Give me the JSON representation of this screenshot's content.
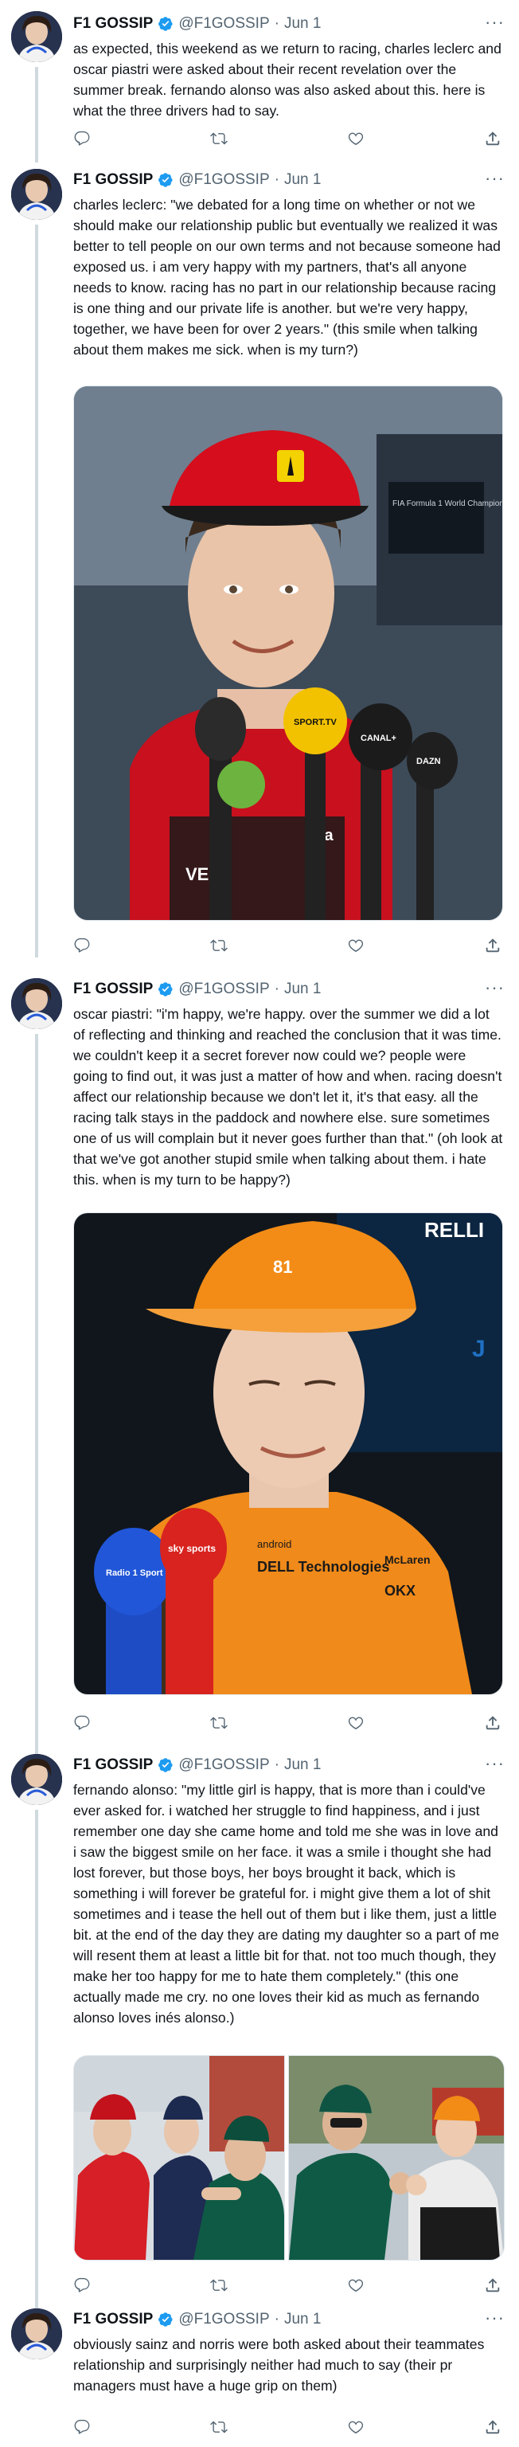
{
  "colors": {
    "accent": "#1d9bf0",
    "text": "#0f1419",
    "muted": "#536471",
    "divider": "#eff3f4"
  },
  "icons": [
    "reply-icon",
    "retweet-icon",
    "like-icon",
    "share-icon",
    "verified-badge-icon",
    "more-options-icon"
  ],
  "tweets": [
    {
      "name": "F1 GOSSIP",
      "handle": "@F1GOSSIP",
      "date": "Jun 1",
      "dot": "·",
      "more": "···",
      "text": "as expected, this weekend as we return to racing, charles leclerc and oscar piastri were asked about their recent revelation over the summer break. fernando alonso was also asked about this. here is what the three drivers had to say."
    },
    {
      "name": "F1 GOSSIP",
      "handle": "@F1GOSSIP",
      "date": "Jun 1",
      "dot": "·",
      "more": "···",
      "text": "charles leclerc: \"we debated for a long time on whether or not we should make our relationship public but eventually we realized it was better to tell people on our own terms and not because someone had exposed us. i am very happy with my partners, that's all anyone needs to know. racing has no part in our relationship because racing is one thing and our private life is another. but we're very happy, together, we have been for over 2 years.\" (this smile when talking about them makes me sick. when is my turn?)",
      "media": {
        "mic_labels": [
          "SPORT.TV",
          "CANAL+",
          "DAZN"
        ],
        "sign_text": "FIA Formula 1 World Championship",
        "sponsor_text": "Ca",
        "sponsor2_text": "VE"
      }
    },
    {
      "name": "F1 GOSSIP",
      "handle": "@F1GOSSIP",
      "date": "Jun 1",
      "dot": "·",
      "more": "···",
      "text": "oscar piastri: \"i'm happy, we're happy. over the summer we did a lot of reflecting and thinking and reached the conclusion that it was time. we couldn't keep it a secret forever now could we? people were going to find out, it was just a matter of how and when. racing doesn't affect our relationship because we don't let it, it's that easy. all the racing talk stays in the paddock and nowhere else. sure sometimes one of us will complain but it never goes further than that.\" (oh look at that we've got another stupid smile when talking about them. i hate this. when is my turn to be happy?)",
      "media": {
        "cap_number": "81",
        "backdrop_text": "RELLI",
        "backdrop_text2": "J",
        "sponsors": [
          "android",
          "DELL Technologies",
          "McLaren",
          "OKX"
        ],
        "mic_labels": [
          "Radio 1 Sport",
          "sky sports"
        ]
      }
    },
    {
      "name": "F1 GOSSIP",
      "handle": "@F1GOSSIP",
      "date": "Jun 1",
      "dot": "·",
      "more": "···",
      "text": "fernando alonso: \"my little girl is happy, that is more than i could've ever asked for. i watched her struggle to find happiness, and i just remember one day she came home and told me she was in love and i saw the biggest smile on her face. it was a smile i thought she had lost forever, but those boys, her boys brought it back, which is something i will forever be grateful for. i might give them a lot of shit sometimes and i tease the hell out of them but i like them, just a little bit. at the end of the day they are dating my daughter so a part of me will resent them at least a little bit for that. not too much though, they make her too happy for me to hate them completely.\" (this one actually made me cry. no one loves their kid as much as fernando alonso loves inés alonso.)"
    },
    {
      "name": "F1 GOSSIP",
      "handle": "@F1GOSSIP",
      "date": "Jun 1",
      "dot": "·",
      "more": "···",
      "text": "obviously sainz and norris were both asked about their teammates relationship and surprisingly neither had much to say (their pr managers must have a huge grip on them)"
    }
  ]
}
